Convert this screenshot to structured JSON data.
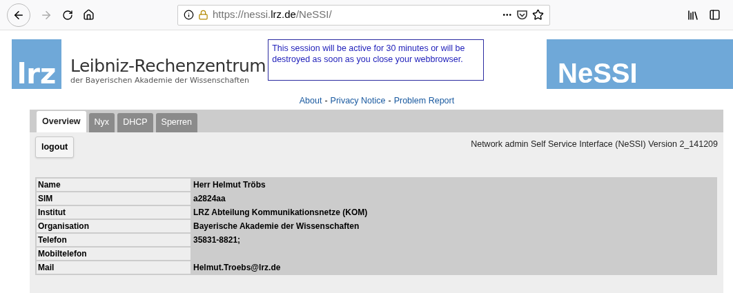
{
  "browser": {
    "url": {
      "prefix": "https://nessi.",
      "domain": "lrz.de",
      "suffix": "/NeSSI/"
    },
    "menu_dots": "•••"
  },
  "header": {
    "logo_mark": "lrz",
    "logo_title": "Leibniz-Rechenzentrum",
    "logo_subtitle": "der Bayerischen Akademie der Wissenschaften",
    "session_notice": "This session will be active for 30 minutes or will be destroyed as soon as you close your webbrowser.",
    "banner": "NeSSI"
  },
  "links": [
    {
      "label": "About"
    },
    {
      "label": "Privacy Notice"
    },
    {
      "label": "Problem Report"
    }
  ],
  "link_separator": "-",
  "tabs": [
    {
      "label": "Overview",
      "selected": true
    },
    {
      "label": "Nyx",
      "selected": false
    },
    {
      "label": "DHCP",
      "selected": false
    },
    {
      "label": "Sperren",
      "selected": false
    }
  ],
  "logout_button": "logout",
  "version": "Network admin Self Service Interface (NeSSI) Version 2_141209",
  "table": {
    "rows": [
      {
        "label": "Name",
        "value": "Herr Helmut Tröbs"
      },
      {
        "label": "SIM",
        "value": "a2824aa"
      },
      {
        "label": "Institut",
        "value": "LRZ Abteilung Kommunikationsnetze (KOM)"
      },
      {
        "label": "Organisation",
        "value": "Bayerische Akademie der Wissenschaften"
      },
      {
        "label": "Telefon",
        "value": "35831-8821;"
      },
      {
        "label": "Mobiltelefon"
      },
      {
        "label": "Mail",
        "value": "Helmut.Troebs@lrz.de"
      }
    ]
  }
}
